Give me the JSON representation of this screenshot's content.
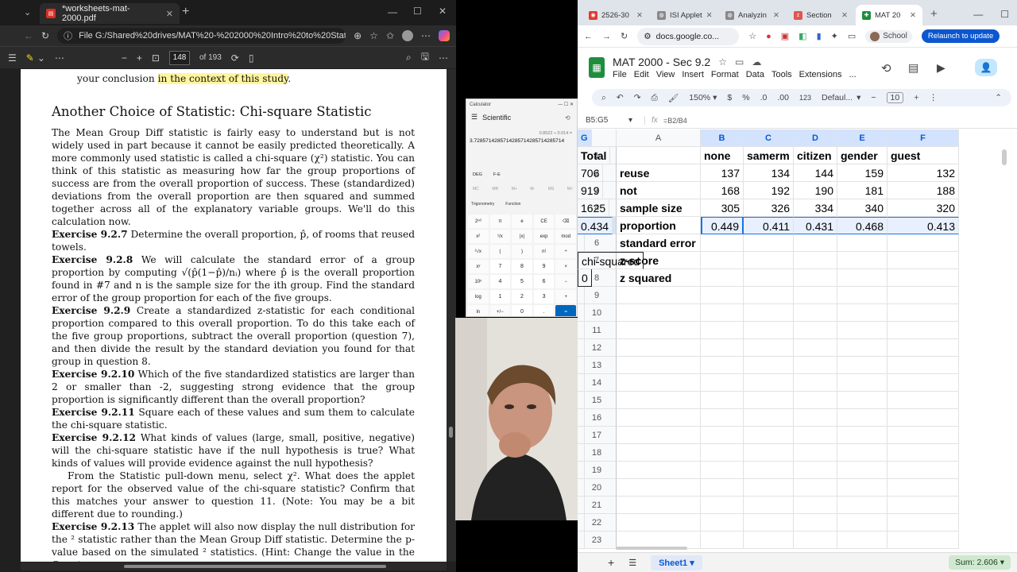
{
  "pdf": {
    "tab_title": "*worksheets-mat-2000.pdf",
    "address": "File   G:/Shared%20drives/MAT%20-%202000%20Intro%20to%20Stats...",
    "page_number": "148",
    "page_total": "of 193",
    "top_fragment_prefix": "your conclusion ",
    "top_fragment_highlight": "in the context of this study",
    "top_fragment_suffix": ".",
    "section_title": "Another Choice of Statistic: Chi-square Statistic",
    "intro": "The Mean Group Diff statistic is fairly easy to understand but is not widely used in part because it cannot be easily predicted theoretically. A more commonly used statistic is called a chi-square (χ²) statistic. You can think of this statistic as measuring how far the group proportions of success are from the overall proportion of success. These (standardized) deviations from the overall proportion are then squared and summed together across all of the explanatory variable groups. We'll do this calculation now.",
    "exercises": [
      {
        "label": "Exercise 9.2.7",
        "text": " Determine the overall proportion, p̂, of rooms that reused towels."
      },
      {
        "label": "Exercise 9.2.8",
        "text": " We will calculate the standard error of a group proportion by computing √(p̂(1−p̂)/nᵢ) where p̂ is the overall proportion found in #7 and n is the sample size for the ith group. Find the standard error of the group proportion for each of the five groups."
      },
      {
        "label": "Exercise 9.2.9",
        "text": " Create a standardized z-statistic for each conditional proportion compared to this overall proportion. To do this take each of the five group proportions, subtract the overall proportion (question 7), and then divide the result by the standard deviation you found for that group in question 8."
      },
      {
        "label": "Exercise 9.2.10",
        "text": " Which of the five standardized statistics are larger than 2 or smaller than -2, suggesting strong evidence that the group proportion is significantly different than the overall proportion?"
      },
      {
        "label": "Exercise 9.2.11",
        "text": " Square each of these values and sum them to calculate the chi-square statistic."
      },
      {
        "label": "Exercise 9.2.12",
        "text": " What kinds of values (large, small, positive, negative) will the chi-square statistic have if the null hypothesis is true? What kinds of values will provide evidence against the null hypothesis?"
      }
    ],
    "para_followup": "From the Statistic pull-down menu, select χ². What does the applet report for the observed value of the chi-square statistic? Confirm that this matches your answer to question 11. (Note: You may be a bit different due to rounding.)",
    "last_exercise": {
      "label": "Exercise 9.2.13",
      "text": " The applet will also now display the null distribution for the ² statistic rather than the Mean Group Diff statistic. Determine the p-value based on the simulated ² statistics. (Hint: Change the value in the Count"
    }
  },
  "calculator": {
    "title": "Calculator",
    "mode": "Scientific",
    "expression": "0.8522 ÷ 0.014 =",
    "display": "3.7285714285714285714285714285714",
    "angle": "DEG",
    "fe": "F-E",
    "memory": [
      "MC",
      "MR",
      "M+",
      "M-",
      "MS",
      "M˅"
    ],
    "trig": "Trigonometry",
    "func": "Function",
    "keys": [
      "2ⁿᵈ",
      "π",
      "e",
      "CE",
      "⌫",
      "x²",
      "¹/x",
      "|x|",
      "exp",
      "mod",
      "²√x",
      "(",
      ")",
      "n!",
      "÷",
      "xʸ",
      "7",
      "8",
      "9",
      "×",
      "10ˣ",
      "4",
      "5",
      "6",
      "−",
      "log",
      "1",
      "2",
      "3",
      "+",
      "ln",
      "+/−",
      "0",
      ".",
      "="
    ]
  },
  "chrome": {
    "tabs": [
      "2526-30",
      "ISI Applet",
      "Analyzin",
      "Section",
      "MAT 20"
    ],
    "url": "docs.google.co...",
    "profile": "School",
    "relaunch": "Relaunch to update"
  },
  "sheets": {
    "title": "MAT 2000 - Sec 9.2",
    "menu": [
      "File",
      "Edit",
      "View",
      "Insert",
      "Format",
      "Data",
      "Tools",
      "Extensions",
      "..."
    ],
    "zoom": "150%",
    "currency": "$",
    "percent": "%",
    "dec_less": ".0",
    "dec_more": ".00",
    "num123": "123",
    "font": "Defaul...",
    "font_size": "10",
    "namebox": "B5:G5",
    "formula": "=B2/B4",
    "columns": [
      "A",
      "B",
      "C",
      "D",
      "E",
      "F",
      "G"
    ],
    "rows": [
      [
        "",
        "none",
        "samerm",
        "citizen",
        "gender",
        "guest",
        "Total"
      ],
      [
        "reuse",
        "137",
        "134",
        "144",
        "159",
        "132",
        "706"
      ],
      [
        "not",
        "168",
        "192",
        "190",
        "181",
        "188",
        "919"
      ],
      [
        "sample size",
        "305",
        "326",
        "334",
        "340",
        "320",
        "1625"
      ],
      [
        "proportion",
        "0.449",
        "0.411",
        "0.431",
        "0.468",
        "0.413",
        "0.434"
      ],
      [
        "standard error",
        "",
        "",
        "",
        "",
        "",
        ""
      ],
      [
        "z-score",
        "",
        "",
        "",
        "",
        "",
        "chi-squared"
      ],
      [
        "z squared",
        "",
        "",
        "",
        "",
        "",
        "0"
      ]
    ],
    "empty_rows": [
      "9",
      "10",
      "11",
      "12",
      "13",
      "14",
      "15",
      "16",
      "17",
      "18",
      "19",
      "20",
      "21",
      "22",
      "23"
    ],
    "sheet_tab": "Sheet1",
    "sum": "Sum: 2.606"
  }
}
